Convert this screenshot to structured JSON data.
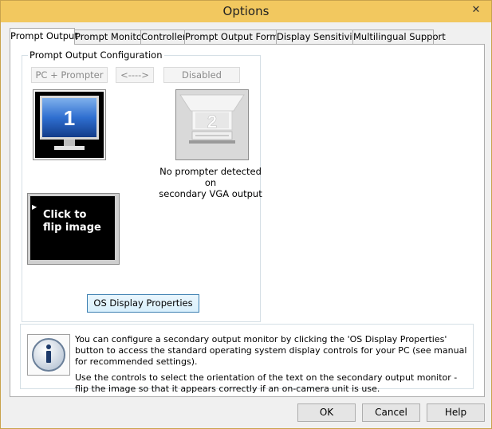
{
  "window": {
    "title": "Options",
    "close_glyph": "✕"
  },
  "tabs": [
    {
      "label": "Prompt Output",
      "active": true
    },
    {
      "label": "Prompt Monitor"
    },
    {
      "label": "Controller"
    },
    {
      "label": "Prompt Output Format"
    },
    {
      "label": "Display Sensitivity"
    },
    {
      "label": "Multilingual Support"
    }
  ],
  "config": {
    "group_label": "Prompt Output Configuration",
    "buttons": [
      "PC + Prompter",
      "<---->",
      "Disabled"
    ],
    "monitor1_number": "1",
    "monitor2_number": "2",
    "no_prompter_line1": "No prompter detected on",
    "no_prompter_line2": "secondary VGA output",
    "flip_line1": "Click to",
    "flip_line2": "flip image",
    "flip_arrow": "▶",
    "os_button": "OS Display Properties"
  },
  "info": {
    "icon": "info-icon",
    "paragraph1": "You can configure a secondary output monitor by clicking the 'OS Display Properties' button to access the standard operating system display controls for your PC (see manual for recommended settings).",
    "paragraph2": "Use the controls to select the orientation of the text on the secondary output monitor - flip the image so that it appears correctly if an on-camera unit is use."
  },
  "footer": {
    "ok": "OK",
    "cancel": "Cancel",
    "help": "Help"
  }
}
